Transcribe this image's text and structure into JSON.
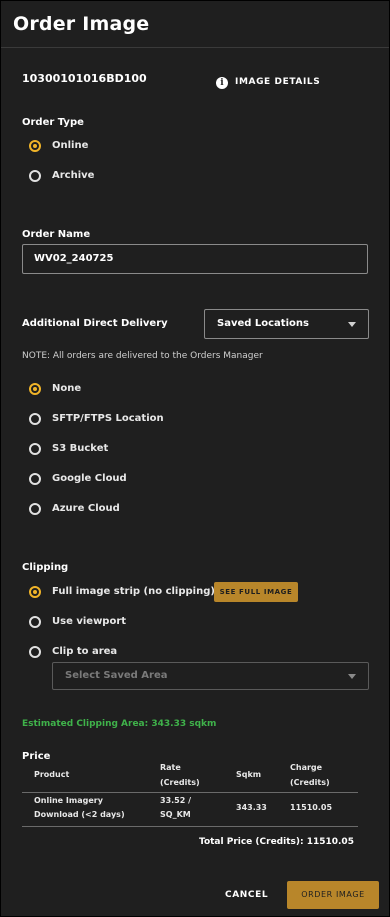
{
  "header": {
    "title": "Order Image"
  },
  "image": {
    "id": "10300101016BD100",
    "details_label": "IMAGE DETAILS"
  },
  "order_type": {
    "label": "Order Type",
    "options": [
      "Online",
      "Archive"
    ],
    "selected": "Online"
  },
  "order_name": {
    "label": "Order Name",
    "value": "WV02_240725"
  },
  "delivery": {
    "label": "Additional Direct Delivery",
    "dropdown_value": "Saved Locations",
    "note": "NOTE: All orders are delivered to the Orders Manager",
    "options": [
      "None",
      "SFTP/FTPS Location",
      "S3 Bucket",
      "Google Cloud",
      "Azure Cloud"
    ],
    "selected": "None"
  },
  "clipping": {
    "label": "Clipping",
    "options": [
      "Full image strip (no clipping)",
      "Use viewport",
      "Clip to area"
    ],
    "selected": "Full image strip (no clipping)",
    "see_full_image_label": "SEE FULL IMAGE",
    "area_placeholder": "Select Saved Area",
    "estimated": "Estimated Clipping Area: 343.33 sqkm"
  },
  "price": {
    "label": "Price",
    "headers": {
      "product": "Product",
      "rate_1": "Rate",
      "rate_2": "(Credits)",
      "sqkm": "Sqkm",
      "charge_1": "Charge",
      "charge_2": "(Credits)"
    },
    "row": {
      "product_1": "Online Imagery",
      "product_2": "Download (<2 days)",
      "rate_1": "33.52 /",
      "rate_2": "SQ_KM",
      "sqkm": "343.33",
      "charge": "11510.05"
    },
    "total": "Total Price (Credits): 11510.05"
  },
  "actions": {
    "cancel_label": "CANCEL",
    "order_label": "ORDER IMAGE"
  },
  "colors": {
    "accent": "#f0b429",
    "estimate_green": "#3fb24a",
    "button_gold": "#b8862a"
  }
}
